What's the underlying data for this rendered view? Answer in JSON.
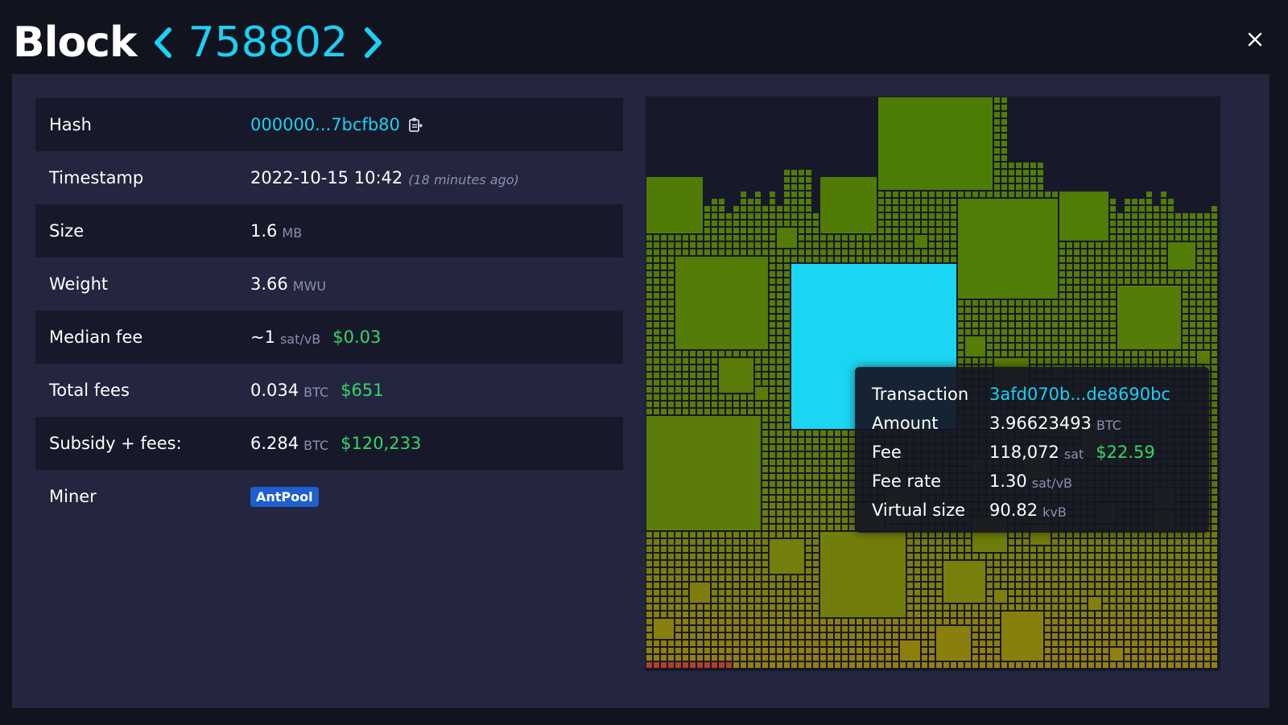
{
  "header": {
    "title": "Block",
    "block_number": "758802"
  },
  "details": {
    "hash": {
      "label": "Hash",
      "value": "000000...7bcfb80"
    },
    "timestamp": {
      "label": "Timestamp",
      "value": "2022-10-15 10:42",
      "relative": "(18 minutes ago)"
    },
    "size": {
      "label": "Size",
      "value": "1.6",
      "unit": "MB"
    },
    "weight": {
      "label": "Weight",
      "value": "3.66",
      "unit": "MWU"
    },
    "median_fee": {
      "label": "Median fee",
      "value": "~1",
      "unit": "sat/vB",
      "fiat": "$0.03"
    },
    "total_fees": {
      "label": "Total fees",
      "value": "0.034",
      "unit": "BTC",
      "fiat": "$651"
    },
    "subsidy_fees": {
      "label": "Subsidy + fees:",
      "value": "6.284",
      "unit": "BTC",
      "fiat": "$120,233"
    },
    "miner": {
      "label": "Miner",
      "value": "AntPool"
    }
  },
  "tooltip": {
    "transaction": {
      "label": "Transaction",
      "value": "3afd070b...de8690bc"
    },
    "amount": {
      "label": "Amount",
      "value": "3.96623493",
      "unit": "BTC"
    },
    "fee": {
      "label": "Fee",
      "value": "118,072",
      "unit": "sat",
      "fiat": "$22.59"
    },
    "fee_rate": {
      "label": "Fee rate",
      "value": "1.30",
      "unit": "sat/vB"
    },
    "virtual_size": {
      "label": "Virtual size",
      "value": "90.82",
      "unit": "kvB"
    }
  },
  "colors": {
    "accent": "#1bd1f4",
    "fiat": "#2fd86a",
    "highlight_tx": "#1bd6f2",
    "low_fee": "#4d7c05",
    "mid_fee": "#87860b",
    "high_fee": "#a9800d"
  },
  "icons": [
    "chevron-left-icon",
    "chevron-right-icon",
    "close-icon",
    "copy-icon"
  ]
}
